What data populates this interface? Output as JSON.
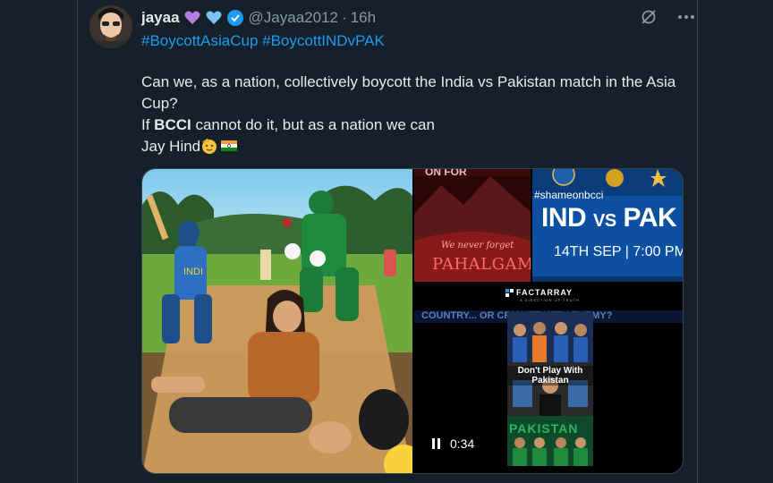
{
  "tweet": {
    "author_name": "jayaa",
    "handle": "@Jayaa2012",
    "separator": "·",
    "time": "16h",
    "hashtags": [
      "#BoycottAsiaCup",
      "#BoycottINDvPAK"
    ],
    "text_line1": "Can we, as a nation, collectively boycott the India vs Pakistan match in the Asia Cup?",
    "text_line2_pre": "If ",
    "text_line2_bold": "BCCI",
    "text_line2_post": " cannot do it, but as a nation we can",
    "text_line3": "Jay Hind"
  },
  "media": {
    "poster_title_left": "IND",
    "poster_title_vs": "VS",
    "poster_title_right": "PAK",
    "poster_hashtag": "#shameonbcci",
    "poster_date": "14TH SEP | 7:00 PM",
    "pahalgam_small": "We never forget",
    "pahalgam_big": "PAHALGAM",
    "video_brand": "FACTARRAY",
    "video_brand_sub": "A DIRECTION OF TRUTH",
    "video_ticker": "COUNTRY... OR CRICKET WITH ENEMY?",
    "video_overlay": "Don't Play With Pakistan",
    "video_pak_banner": "PAKISTAN",
    "video_duration": "0:34"
  },
  "colors": {
    "background": "#15202b",
    "link": "#1d9bf0",
    "muted": "#8b98a5",
    "text": "#e7e9ea",
    "border": "#38444d"
  },
  "icons": [
    "grok-icon",
    "more-icon",
    "verified-badge-icon",
    "purple-heart-icon",
    "blue-heart-icon",
    "salute-emoji-icon",
    "india-flag-icon",
    "pause-icon"
  ]
}
